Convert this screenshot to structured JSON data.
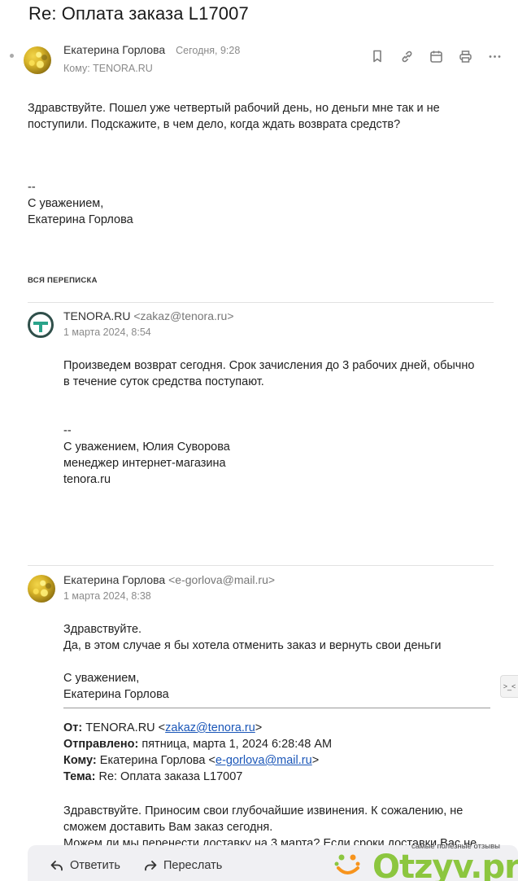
{
  "subject": "Re: Оплата заказа L17007",
  "current_message": {
    "sender": "Екатерина Горлова",
    "time": "Сегодня, 9:28",
    "to": "Кому: TENORA.RU",
    "body": [
      "Здравствуйте. Пошел уже четвертый рабочий день, но деньги мне так и не",
      "поступили. Подскажите, в чем дело, когда ждать возврата средств?"
    ],
    "signature": [
      "--",
      "С уважением,",
      "Екатерина Горлова"
    ]
  },
  "toolbar": {
    "icons": [
      "bookmark-icon",
      "link-icon",
      "calendar-icon",
      "print-icon",
      "more-icon"
    ]
  },
  "thread_label": "ВСЯ ПЕРЕПИСКА",
  "thread": [
    {
      "sender": "TENORA.RU",
      "email": "<zakaz@tenora.ru>",
      "date": "1 марта 2024, 8:54",
      "body": [
        "Произведем возврат сегодня. Срок зачисления до 3 рабочих дней, обычно",
        "в течение суток средства поступают."
      ],
      "signature": [
        "--",
        "С уважением, Юлия Суворова",
        "менеджер интернет-магазина",
        "tenora.ru"
      ]
    },
    {
      "sender": "Екатерина Горлова",
      "email": "<e-gorlova@mail.ru>",
      "date": "1 марта 2024, 8:38",
      "body": [
        "Здравствуйте.",
        "Да, в этом случае я бы хотела отменить заказ и вернуть свои деньги"
      ],
      "signature": [
        "С уважением,",
        "Екатерина Горлова"
      ],
      "quoted": {
        "from_label": "От:",
        "from_name": "TENORA.RU <",
        "from_email": "zakaz@tenora.ru",
        "from_end": ">",
        "sent_label": "Отправлено:",
        "sent_value": "пятница, марта 1, 2024 6:28:48 AM",
        "to_label": "Кому:",
        "to_name": "Екатерина Горлова <",
        "to_email": "e-gorlova@mail.ru",
        "to_end": ">",
        "subject_label": "Тема:",
        "subject_value": "Re: Оплата заказа L17007",
        "body": [
          "Здравствуйте. Приносим свои глубочайшие извинения. К сожалению, не",
          "сможем доставить Вам заказ сегодня.",
          "Можем ли мы перенести доставку на 3 марта? Если сроки доставки Вас не"
        ]
      }
    }
  ],
  "actions": {
    "reply": "Ответить",
    "forward": "Переслать"
  },
  "side_chip": ">_<",
  "watermark": {
    "tagline": "самые полезные отзывы",
    "brand": "Otzyv",
    "suffix": ".pro"
  }
}
